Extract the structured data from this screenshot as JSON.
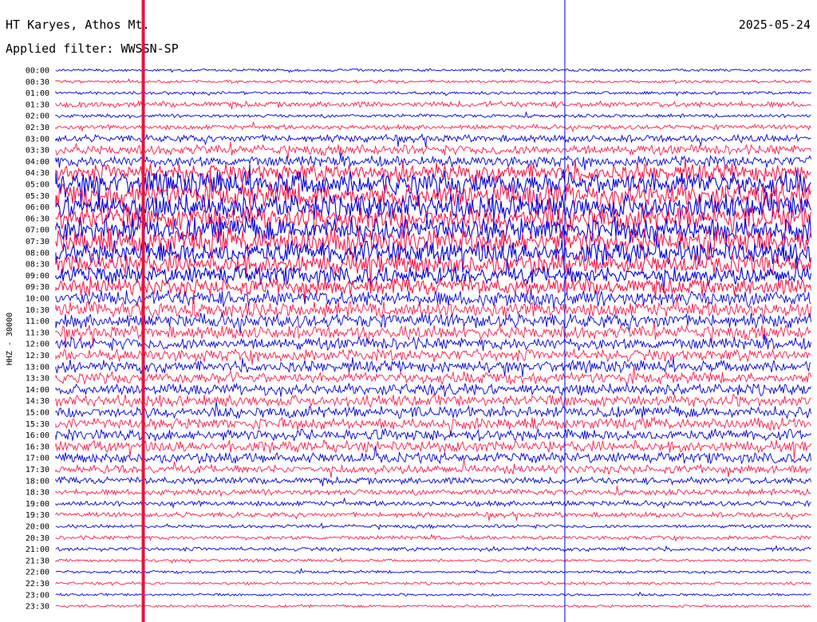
{
  "header": {
    "station": "HT Karyes, Athos Mt.",
    "date": "2025-05-24",
    "filter": "Applied filter: WWSSN-SP"
  },
  "colors": {
    "trace_a": "#0000e0",
    "trace_b": "#ff1a4a",
    "marker_red": "#e8123c",
    "marker_blue": "#0000e0",
    "text": "#000000"
  },
  "chart_data": {
    "type": "line",
    "title": "HT Karyes, Athos Mt.",
    "subtitle": "Applied filter: WWSSN-SP",
    "ylabel": "HHZ - 30000",
    "xlabel": "",
    "y_tick_labels": [
      "00:00",
      "00:30",
      "01:00",
      "01:30",
      "02:00",
      "02:30",
      "03:00",
      "03:30",
      "04:00",
      "04:30",
      "05:00",
      "05:30",
      "06:00",
      "06:30",
      "07:00",
      "07:30",
      "08:00",
      "08:30",
      "09:00",
      "09:30",
      "10:00",
      "10:30",
      "11:00",
      "11:30",
      "12:00",
      "12:30",
      "13:00",
      "13:30",
      "14:00",
      "14:30",
      "15:00",
      "15:30",
      "16:00",
      "16:30",
      "17:00",
      "17:30",
      "18:00",
      "18:30",
      "19:00",
      "19:30",
      "20:00",
      "20:30",
      "21:00",
      "21:30",
      "22:00",
      "22:30",
      "23:00",
      "23:30"
    ],
    "minutes_per_row": 30,
    "trace_colors_alternating": [
      "#0000e0",
      "#ff1a4a"
    ],
    "row_activity_level": [
      0.05,
      0.05,
      0.06,
      0.18,
      0.08,
      0.14,
      0.25,
      0.35,
      0.4,
      0.7,
      0.95,
      1.0,
      1.0,
      1.0,
      1.0,
      1.0,
      0.9,
      0.8,
      0.7,
      0.65,
      0.6,
      0.6,
      0.55,
      0.5,
      0.45,
      0.45,
      0.42,
      0.42,
      0.42,
      0.42,
      0.42,
      0.42,
      0.42,
      0.42,
      0.38,
      0.3,
      0.22,
      0.18,
      0.16,
      0.15,
      0.08,
      0.1,
      0.1,
      0.05,
      0.05,
      0.05,
      0.04,
      0.04
    ],
    "markers": [
      {
        "type": "red-vertical",
        "position_fraction": 0.107
      },
      {
        "type": "blue-vertical",
        "position_fraction": 0.623
      }
    ]
  }
}
